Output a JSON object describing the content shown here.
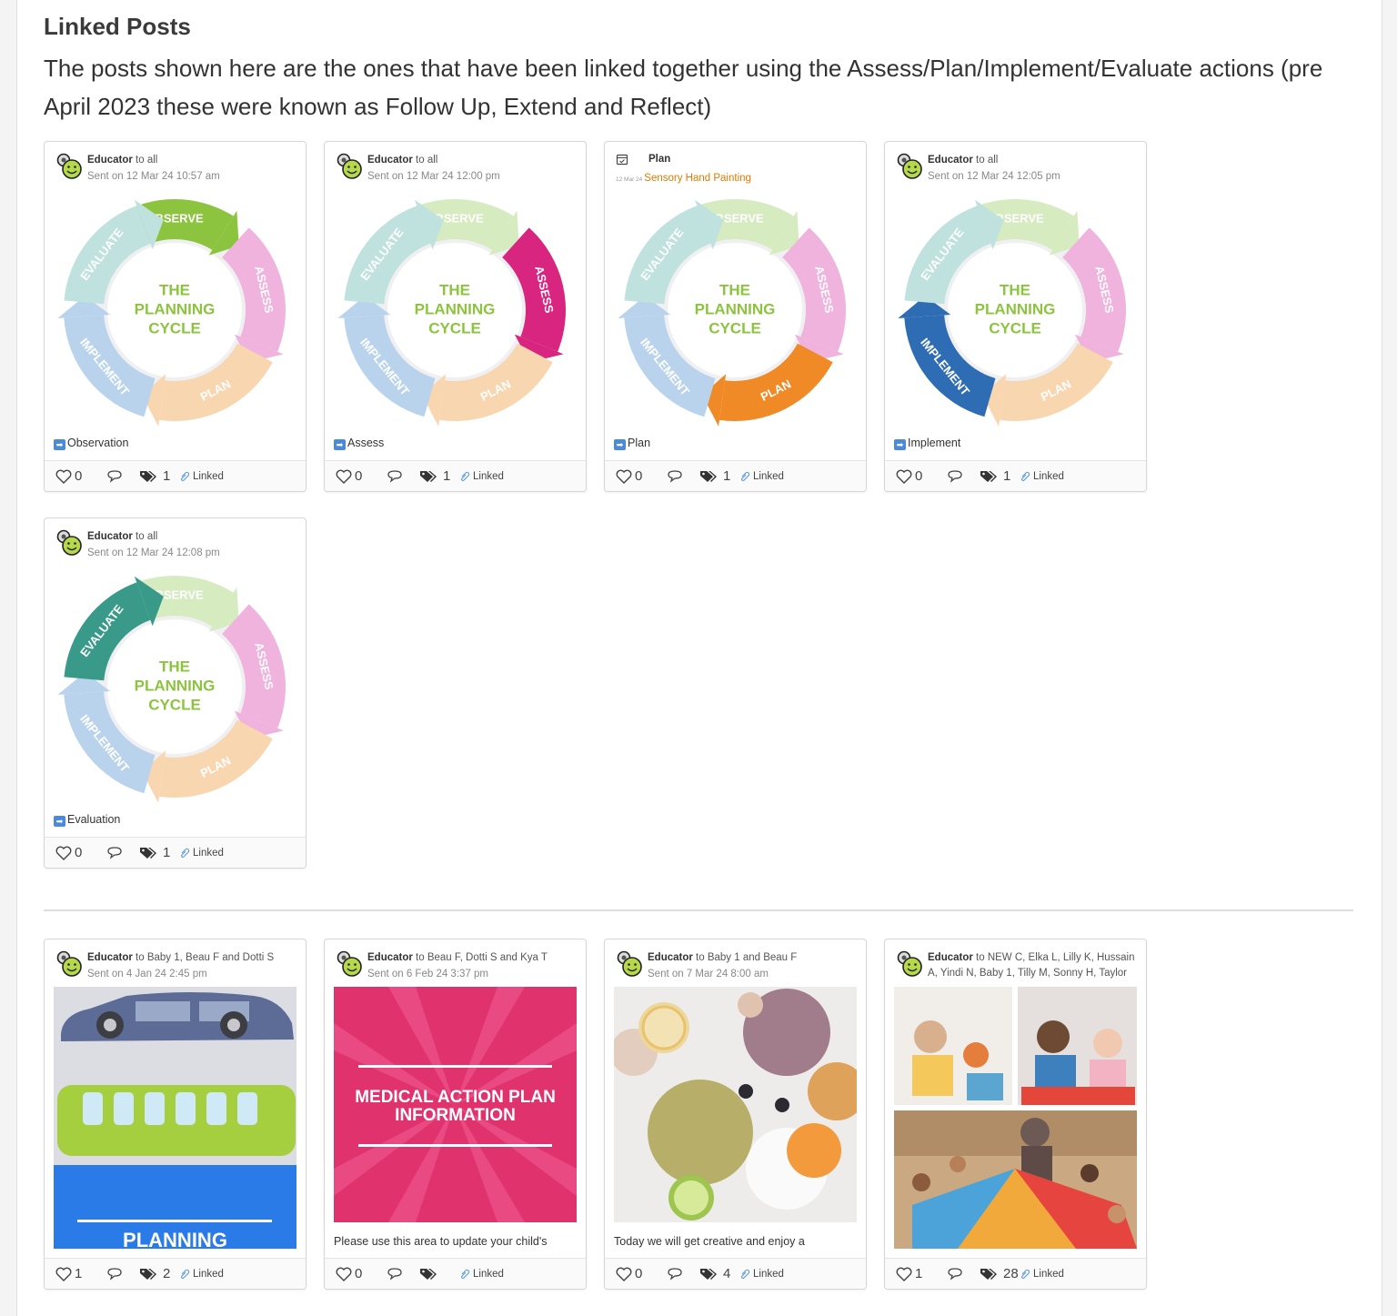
{
  "page": {
    "title": "Linked Posts",
    "description": "The posts shown here are the ones that have been linked together using the Assess/Plan/Implement/Evaluate actions (pre April 2023 these were known as Follow Up, Extend and Reflect)"
  },
  "cycle": {
    "labels": {
      "observe": "OBSERVE",
      "assess": "ASSESS",
      "plan": "PLAN",
      "implement": "IMPLEMENT",
      "evaluate": "EVALUATE"
    },
    "center": [
      "THE",
      "PLANNING",
      "CYCLE"
    ]
  },
  "linked_label": "Linked",
  "cards": [
    {
      "author": "Educator",
      "audience": " to all",
      "sent": "Sent on 12 Mar 24 10:57 am",
      "caption": "Observation",
      "likes": "0",
      "tags": "1",
      "highlight": "observe"
    },
    {
      "author": "Educator",
      "audience": " to all",
      "sent": "Sent on 12 Mar 24 12:00 pm",
      "caption": "Assess",
      "likes": "0",
      "tags": "1",
      "highlight": "assess"
    },
    {
      "plan_title": "Plan",
      "plan_date": "12 Mar 24",
      "plan_name": "Sensory Hand Painting",
      "caption": "Plan",
      "likes": "0",
      "tags": "1",
      "highlight": "plan"
    },
    {
      "author": "Educator",
      "audience": " to all",
      "sent": "Sent on 12 Mar 24 12:05 pm",
      "caption": "Implement",
      "likes": "0",
      "tags": "1",
      "highlight": "implement"
    },
    {
      "author": "Educator",
      "audience": " to all",
      "sent": "Sent on 12 Mar 24 12:08 pm",
      "caption": "Evaluation",
      "likes": "0",
      "tags": "1",
      "highlight": "evaluate"
    }
  ],
  "cards2": [
    {
      "author": "Educator",
      "audience": " to Baby 1, Beau F and Dotti S",
      "sent": "Sent on 4 Jan 24 2:45 pm",
      "thumb_text": "PLANNING",
      "likes": "1",
      "tags": "2"
    },
    {
      "author": "Educator",
      "audience": " to Beau F, Dotti S and Kya T",
      "sent": "Sent on 6 Feb 24 3:37 pm",
      "thumb_text": "MEDICAL ACTION PLAN INFORMATION",
      "snippet": "Please use this area to update your child's",
      "likes": "0",
      "tags": ""
    },
    {
      "author": "Educator",
      "audience": " to Baby 1 and Beau F",
      "sent": "Sent on 7 Mar 24 8:00 am",
      "snippet": "Today we will get creative and enjoy a",
      "likes": "0",
      "tags": "4"
    },
    {
      "author": "Educator",
      "audience": " to NEW C, Elka L, Lilly K, Hussain A, Yindi N, Baby 1, Tilly M, Sonny H, Taylor",
      "likes": "1",
      "tags": "28"
    }
  ],
  "colors": {
    "observe": "#8cc43f",
    "assess": "#d8257f",
    "plan": "#ef8a27",
    "implement": "#2e6db4",
    "evaluate": "#3a9a8a",
    "observe_light": "#d6ebbf",
    "assess_light": "#efb3dd",
    "plan_light": "#f8d6b0",
    "implement_light": "#b9d3ec",
    "evaluate_light": "#bfe2df",
    "plan_link": "#e07b00",
    "medical": "#e0336e",
    "planning_bg": "#2a7ae8"
  }
}
